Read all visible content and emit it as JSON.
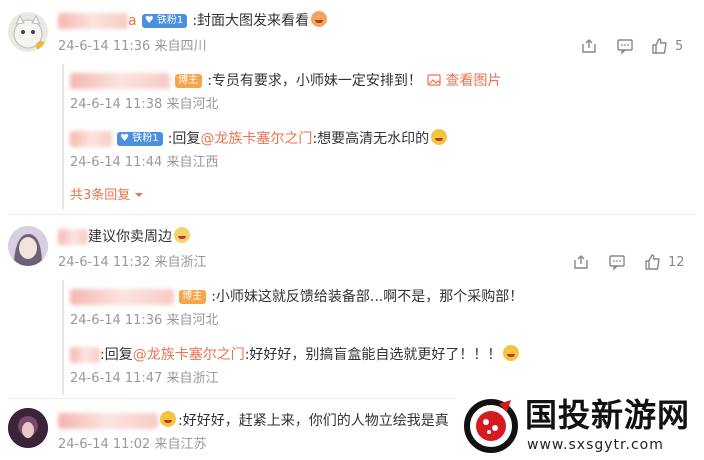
{
  "comments": [
    {
      "badge": "铁粉1",
      "name_suffix": "a",
      "text": ":封面大图发来看看",
      "time": "24-6-14 11:36",
      "location": "来自四川",
      "likes": "5",
      "replies": [
        {
          "badge": "博主",
          "text": ":专员有要求，小师妹一定安排到！",
          "link": "查看图片",
          "time": "24-6-14 11:38",
          "location": "来自河北"
        },
        {
          "badge": "铁粉1",
          "prefix": ":回复",
          "mention": "@龙族卡塞尔之门",
          "text": ":想要高清无水印的",
          "time": "24-6-14 11:44",
          "location": "来自江西"
        }
      ],
      "more_replies": "共3条回复"
    },
    {
      "text": "建议你卖周边",
      "time": "24-6-14 11:32",
      "location": "来自浙江",
      "likes": "12",
      "replies": [
        {
          "badge": "博主",
          "text": ":小师妹这就反馈给装备部...啊不是，那个采购部！",
          "time": "24-6-14 11:36",
          "location": "来自河北"
        },
        {
          "prefix": ":回复",
          "mention": "@龙族卡塞尔之门",
          "text": ":好好好，别搞盲盒能自选就更好了！！！",
          "time": "24-6-14 11:47",
          "location": "来自浙江"
        }
      ]
    },
    {
      "text": ":好好好，赶紧上来，你们的人物立绘我是真",
      "time": "24-6-14 11:02",
      "location": "来自江苏"
    }
  ],
  "watermark": {
    "title": "国投新游网",
    "url": "www.sxsgytr.com"
  },
  "colors": {
    "link": "#eb7350",
    "meta": "#999999",
    "badge_blue": "#4a8fe0",
    "badge_orange": "#f5a54a"
  }
}
